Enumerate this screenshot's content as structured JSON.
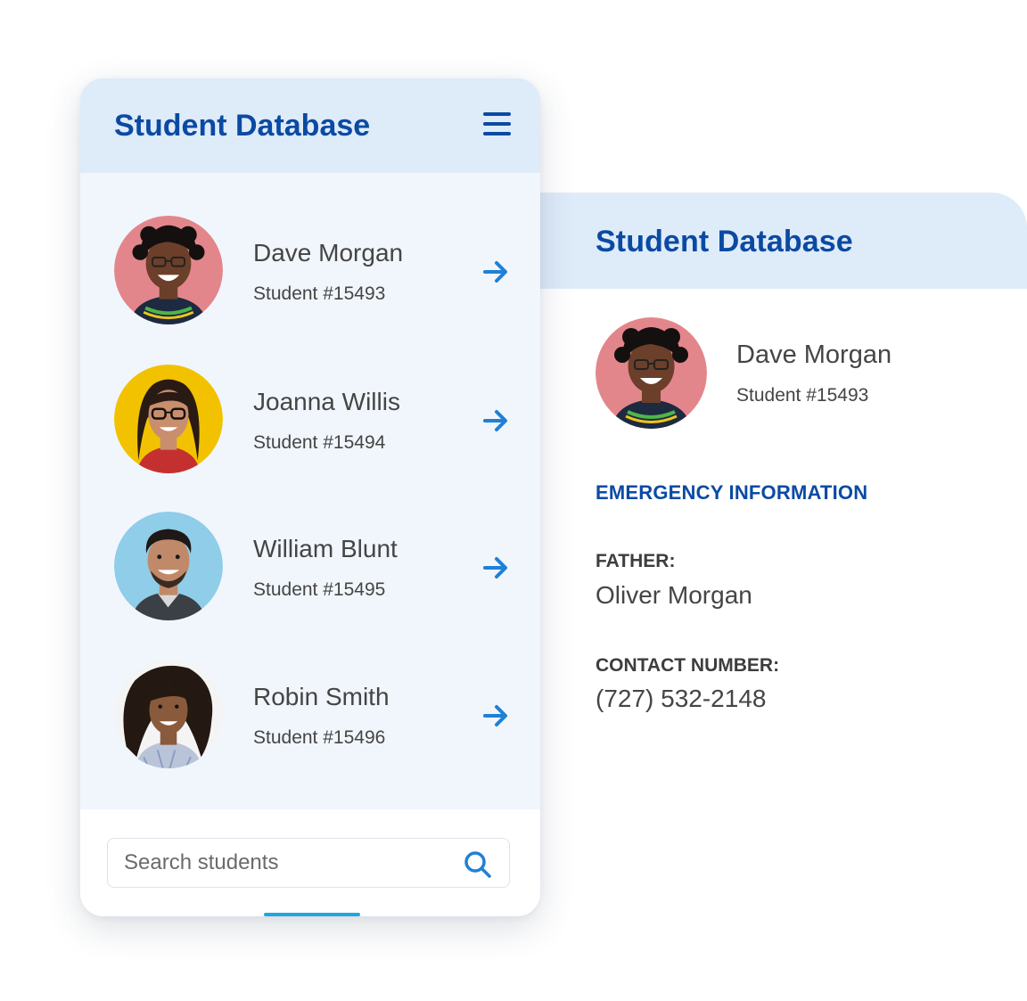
{
  "phone": {
    "title": "Student Database",
    "menu_icon": "hamburger-menu-icon",
    "students": [
      {
        "name": "Dave Morgan",
        "id_label": "Student #15493",
        "avatar_bg": "#e3868c",
        "skin": "#6b3f2a",
        "hair": "#141010",
        "arrow_icon": "arrow-right-icon"
      },
      {
        "name": "Joanna Willis",
        "id_label": "Student #15494",
        "avatar_bg": "#f2c200",
        "skin": "#c98e6d",
        "hair": "#2a1a14",
        "arrow_icon": "arrow-right-icon"
      },
      {
        "name": "William Blunt",
        "id_label": "Student #15495",
        "avatar_bg": "#8fcde8",
        "skin": "#c08a6a",
        "hair": "#1e1816",
        "arrow_icon": "arrow-right-icon"
      },
      {
        "name": "Robin Smith",
        "id_label": "Student #15496",
        "avatar_bg": "#f4f4f4",
        "skin": "#8a5a3c",
        "hair": "#241812",
        "arrow_icon": "arrow-right-icon"
      }
    ],
    "search": {
      "placeholder": "Search students",
      "icon": "search-icon"
    }
  },
  "detail": {
    "title": "Student Database",
    "student": {
      "name": "Dave Morgan",
      "id_label": "Student #15493",
      "avatar_bg": "#e3868c"
    },
    "emergency_heading": "EMERGENCY INFORMATION",
    "father_label": "FATHER:",
    "father_value": "Oliver Morgan",
    "contact_label": "CONTACT NUMBER:",
    "contact_value": "(727) 532-2148"
  },
  "colors": {
    "brand_blue": "#0b4aa3",
    "accent_blue": "#1f80d6",
    "header_bg": "#deebf9",
    "list_bg": "#f1f6fd"
  }
}
